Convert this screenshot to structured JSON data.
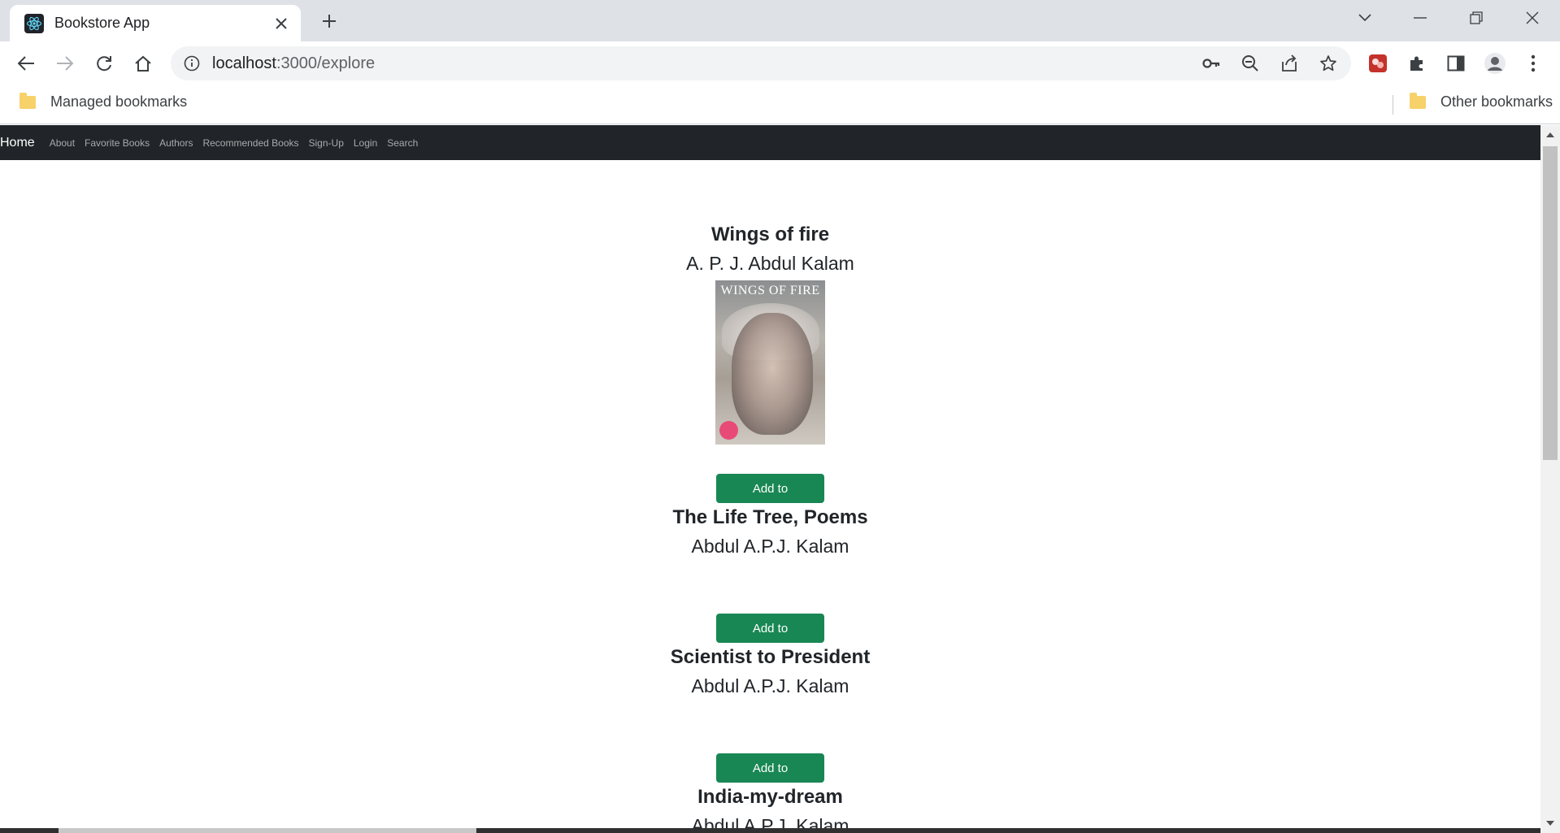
{
  "browser": {
    "tab_title": "Bookstore App",
    "url_host": "localhost",
    "url_path": ":3000/explore",
    "bookmarks": {
      "managed": "Managed bookmarks",
      "other": "Other bookmarks"
    }
  },
  "navbar": {
    "brand": "Home",
    "links": [
      "About",
      "Favorite Books",
      "Authors",
      "Recommended Books",
      "Sign-Up",
      "Login",
      "Search"
    ]
  },
  "books": [
    {
      "title": "Wings of fire",
      "author": "A. P. J. Abdul Kalam",
      "has_cover": true,
      "cover_text": "WINGS OF FIRE",
      "button": "Add to Favorites"
    },
    {
      "title": "The Life Tree, Poems",
      "author": "Abdul A.P.J. Kalam",
      "has_cover": false,
      "button": "Add to Favorites"
    },
    {
      "title": "Scientist to President",
      "author": "Abdul A.P.J. Kalam",
      "has_cover": false,
      "button": "Add to Favorites"
    },
    {
      "title": "India-my-dream",
      "author": "Abdul A.P.J. Kalam",
      "has_cover": false,
      "button": ""
    }
  ],
  "colors": {
    "navbar_bg": "#212529",
    "button_bg": "#198754",
    "tabstrip_bg": "#dee1e6"
  }
}
